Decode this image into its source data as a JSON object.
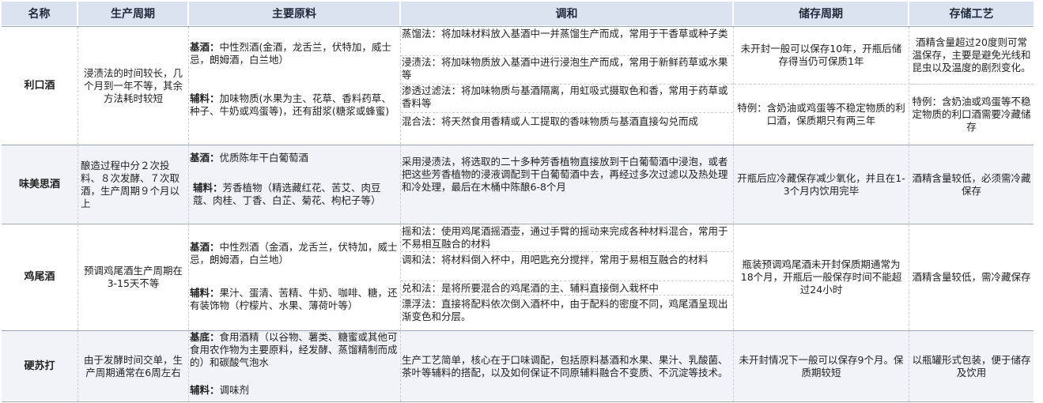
{
  "headers": [
    "名称",
    "生产周期",
    "主要原料",
    "调和",
    "储存周期",
    "存储工艺"
  ],
  "rows": [
    {
      "name": "利口酒",
      "cycle": "浸渍法的时间较长，几个月到一年不等，其余方法耗时较短",
      "materials": [
        {
          "label": "基酒：",
          "text": "中性烈酒(金酒，龙舌兰，伏特加，威士忌，朗姆酒，白兰地）"
        },
        {
          "label": "辅料：",
          "text": "加味物质(水果为主、花草、香料药草、种子、牛奶或鸡蛋等)，还有甜浆(糖浆或蜂蜜)"
        }
      ],
      "blend": [
        "蒸馏法：将加味材料放入基酒中一并蒸馏生产而成，常用于干香草或种子类",
        "浸渍法：将加味物质放入基酒中进行浸泡生产而成，常用于新鲜药草或水果等",
        "渗透过滤法：将加味物质与基酒隔离，用虹吸式摄取色和香，常用于药草或香料等",
        "混合法：将天然食用香精或人工提取的香味物质与基酒直接勾兑而成"
      ],
      "storage": [
        "未开封一般可以保存10年，开瓶后储存得当仍可保质1年",
        "特例：含奶油或鸡蛋等不稳定物质的利口酒，保质期只有两三年"
      ],
      "process": [
        "酒精含量超过20度则可常温保存，主要是避免光线和昆虫以及温度的剧烈变化。",
        "特例：含奶油或鸡蛋等不稳定物质的利口酒需要冷藏储存"
      ]
    },
    {
      "name": "味美思酒",
      "cycle": "酿造过程中分２次投料、８次发酵、７次取酒，生产周期９个月以上",
      "materials": [
        {
          "label": "基酒：",
          "text": "优质陈年干白葡萄酒"
        },
        {
          "label": "辅料：",
          "text": "芳香植物（精选藏红花、苦艾、肉豆蔻、肉桂、丁香、白芷、菊花、枸杞子等）"
        }
      ],
      "blend": [
        "采用浸渍法，将选取的二十多种芳香植物直接放到干白葡萄酒中浸泡，或者把这些芳香植物的浸液调配到干白葡萄酒中去，再经过多次过滤以及热处理和冷处理，最后在木桶中陈酿6-8个月"
      ],
      "storage": [
        "开瓶后应冷藏保存减少氧化，并且在1-3个月内饮用完毕"
      ],
      "process": [
        "酒精含量较低，必须需冷藏保存"
      ]
    },
    {
      "name": "鸡尾酒",
      "cycle": "预调鸡尾酒生产周期在3-15天不等",
      "materials": [
        {
          "label": "基酒：",
          "text": "中性烈酒（金酒，龙舌兰，伏特加，威士忌，朗姆酒，白兰地）"
        },
        {
          "label": "辅料：",
          "text": "果汁、蛋清、苦精、牛奶、咖啡、糖，还有装饰物（柠檬片、水果、薄荷叶等）"
        }
      ],
      "blend": [
        "摇和法：使用鸡尾酒摇酒壶，通过手臂的摇动来完成各种材料混合，常用于不易相互融合的材料",
        "调和法：将材料倒入杯中，用吧匙充分搅拌，常用于易相互融合的材料",
        "兑和法：是将所要混合的鸡尾酒的主、辅料直接倒入栽杯中",
        "漂浮法：直接将配料依次倒入酒杯中，由于配料的密度不同，鸡尾酒呈现出渐变色和分层。"
      ],
      "storage": [
        "瓶装预调鸡尾酒未开封保质期通常为18个月，开瓶后一般保存时间不能超过24小时"
      ],
      "process": [
        "酒精含量较低，需冷藏保存"
      ]
    },
    {
      "name": "硬苏打",
      "cycle": "由于发酵时间交单，生产周期通常在6周左右",
      "materials": [
        {
          "label": "基底：",
          "text": "食用酒精（以谷物、薯类、糖蜜或其他可食用农作物为主要原料，经发酵、蒸馏精制而成的）和碳酸气泡水"
        },
        {
          "label": "辅料：",
          "text": "调味剂"
        }
      ],
      "blend": [
        "生产工艺简单，核心在于口味调配，包括原料基酒和水果、果汁、乳酸菌、茶叶等辅料的搭配，以及如何保证不同原辅料融合不变质、不沉淀等技术。"
      ],
      "storage": [
        "未开封情况下一般可以保存9个月。保质期较短"
      ],
      "process": [
        "以瓶罐形式包装，便于储存及饮用"
      ]
    }
  ]
}
